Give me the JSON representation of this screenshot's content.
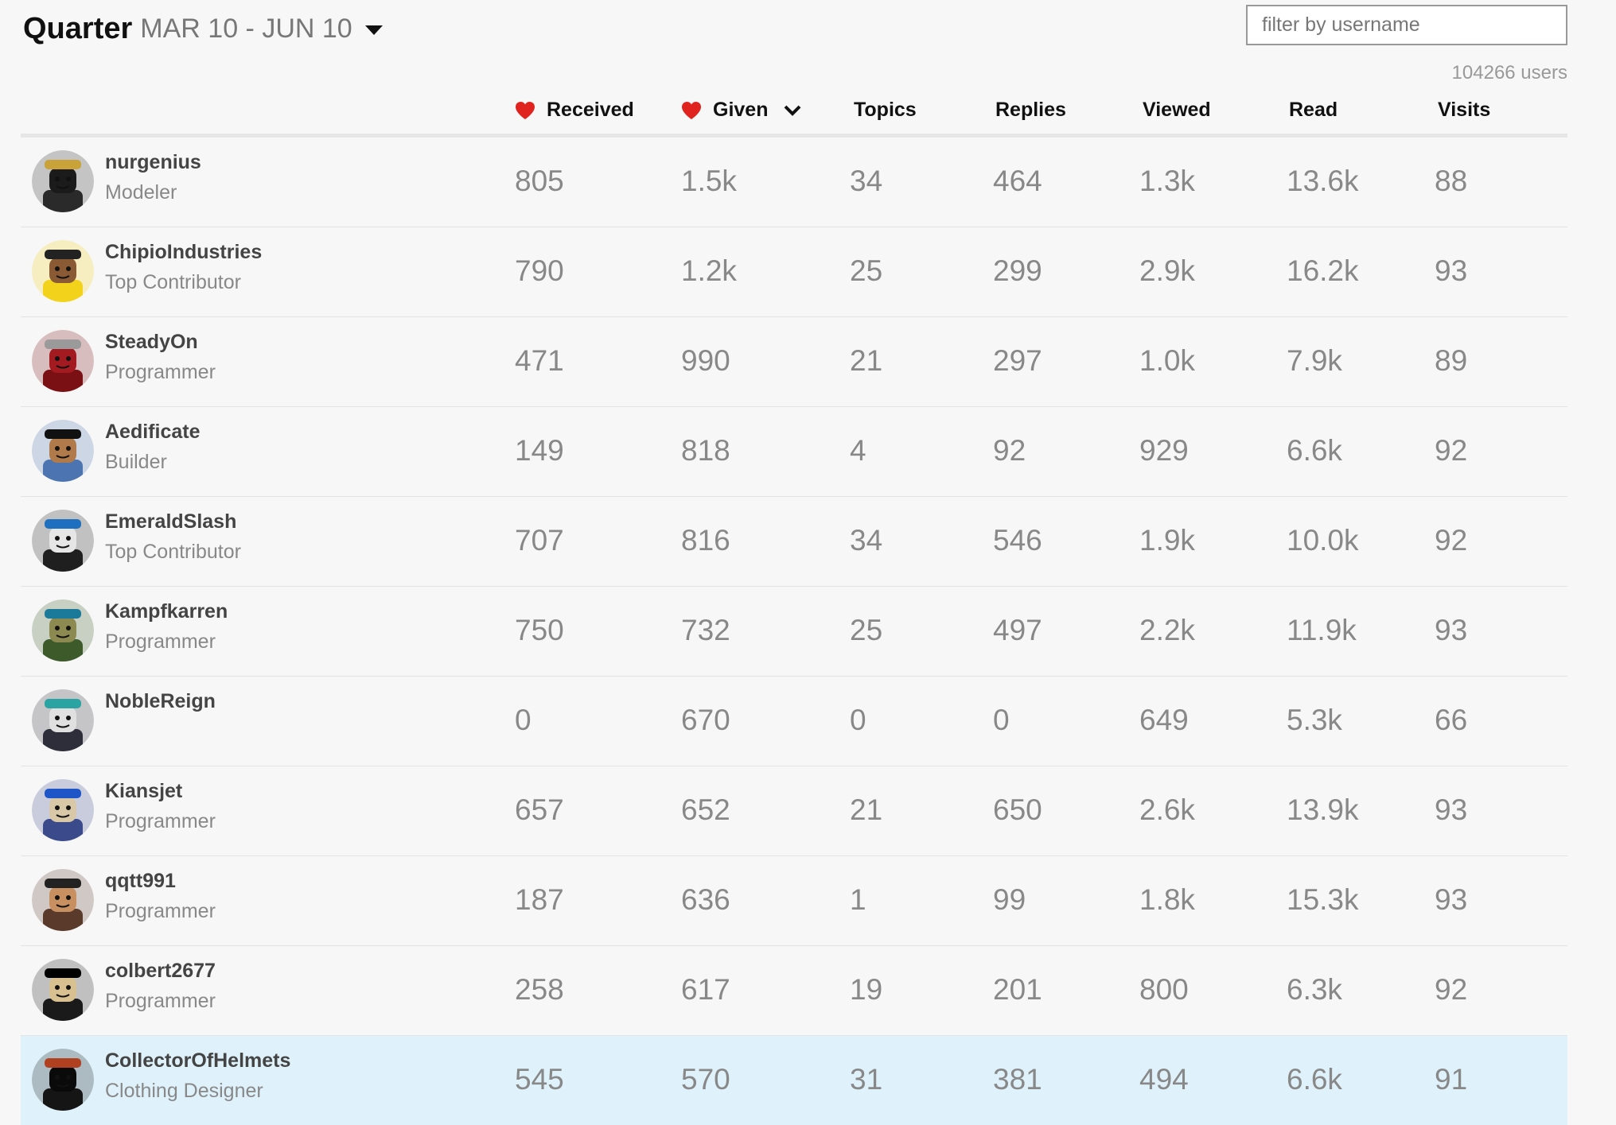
{
  "header": {
    "title": "Quarter",
    "range": "MAR 10 - JUN 10"
  },
  "filter": {
    "placeholder": "filter by username"
  },
  "user_count": "104266 users",
  "columns": {
    "received": "Received",
    "given": "Given",
    "topics": "Topics",
    "replies": "Replies",
    "viewed": "Viewed",
    "read": "Read",
    "visits": "Visits"
  },
  "colors": {
    "heart": "#e0231e",
    "highlight": "#dff2fb"
  },
  "rows": [
    {
      "username": "nurgenius",
      "title": "Modeler",
      "received": "805",
      "given": "1.5k",
      "topics": "34",
      "replies": "464",
      "viewed": "1.3k",
      "read": "13.6k",
      "visits": "88",
      "avatar": {
        "bg": "#2a2a2a",
        "face": "#1b1b1b",
        "accent": "#c9a23a"
      }
    },
    {
      "username": "ChipioIndustries",
      "title": "Top Contributor",
      "received": "790",
      "given": "1.2k",
      "topics": "25",
      "replies": "299",
      "viewed": "2.9k",
      "read": "16.2k",
      "visits": "93",
      "avatar": {
        "bg": "#f2d21a",
        "face": "#8a5a34",
        "accent": "#222222"
      }
    },
    {
      "username": "SteadyOn",
      "title": "Programmer",
      "received": "471",
      "given": "990",
      "topics": "21",
      "replies": "297",
      "viewed": "1.0k",
      "read": "7.9k",
      "visits": "89",
      "avatar": {
        "bg": "#7a0f14",
        "face": "#a31a20",
        "accent": "#9a9a9a"
      }
    },
    {
      "username": "Aedificate",
      "title": "Builder",
      "received": "149",
      "given": "818",
      "topics": "4",
      "replies": "92",
      "viewed": "929",
      "read": "6.6k",
      "visits": "92",
      "avatar": {
        "bg": "#4c74b0",
        "face": "#b07a4a",
        "accent": "#111111"
      }
    },
    {
      "username": "EmeraldSlash",
      "title": "Top Contributor",
      "received": "707",
      "given": "816",
      "topics": "34",
      "replies": "546",
      "viewed": "1.9k",
      "read": "10.0k",
      "visits": "92",
      "avatar": {
        "bg": "#1f1f1f",
        "face": "#e6e6e6",
        "accent": "#1f6fc0"
      }
    },
    {
      "username": "Kampfkarren",
      "title": "Programmer",
      "received": "750",
      "given": "732",
      "topics": "25",
      "replies": "497",
      "viewed": "2.2k",
      "read": "11.9k",
      "visits": "93",
      "avatar": {
        "bg": "#3d5a2a",
        "face": "#8c8a50",
        "accent": "#1b7a9a"
      }
    },
    {
      "username": "NobleReign",
      "title": "",
      "received": "0",
      "given": "670",
      "topics": "0",
      "replies": "0",
      "viewed": "649",
      "read": "5.3k",
      "visits": "66",
      "avatar": {
        "bg": "#2e2e3a",
        "face": "#e0e0e0",
        "accent": "#2aa3a3"
      }
    },
    {
      "username": "Kiansjet",
      "title": "Programmer",
      "received": "657",
      "given": "652",
      "topics": "21",
      "replies": "650",
      "viewed": "2.6k",
      "read": "13.9k",
      "visits": "93",
      "avatar": {
        "bg": "#3a4a8a",
        "face": "#d9c8a8",
        "accent": "#1e56c8"
      }
    },
    {
      "username": "qqtt991",
      "title": "Programmer",
      "received": "187",
      "given": "636",
      "topics": "1",
      "replies": "99",
      "viewed": "1.8k",
      "read": "15.3k",
      "visits": "93",
      "avatar": {
        "bg": "#5a3a2a",
        "face": "#c89060",
        "accent": "#222222"
      }
    },
    {
      "username": "colbert2677",
      "title": "Programmer",
      "received": "258",
      "given": "617",
      "topics": "19",
      "replies": "201",
      "viewed": "800",
      "read": "6.3k",
      "visits": "92",
      "avatar": {
        "bg": "#1a1a1a",
        "face": "#d8c090",
        "accent": "#000000"
      }
    },
    {
      "username": "CollectorOfHelmets",
      "title": "Clothing Designer",
      "received": "545",
      "given": "570",
      "topics": "31",
      "replies": "381",
      "viewed": "494",
      "read": "6.6k",
      "visits": "91",
      "highlight": true,
      "avatar": {
        "bg": "#151515",
        "face": "#0a0a0a",
        "accent": "#b04020"
      }
    }
  ]
}
